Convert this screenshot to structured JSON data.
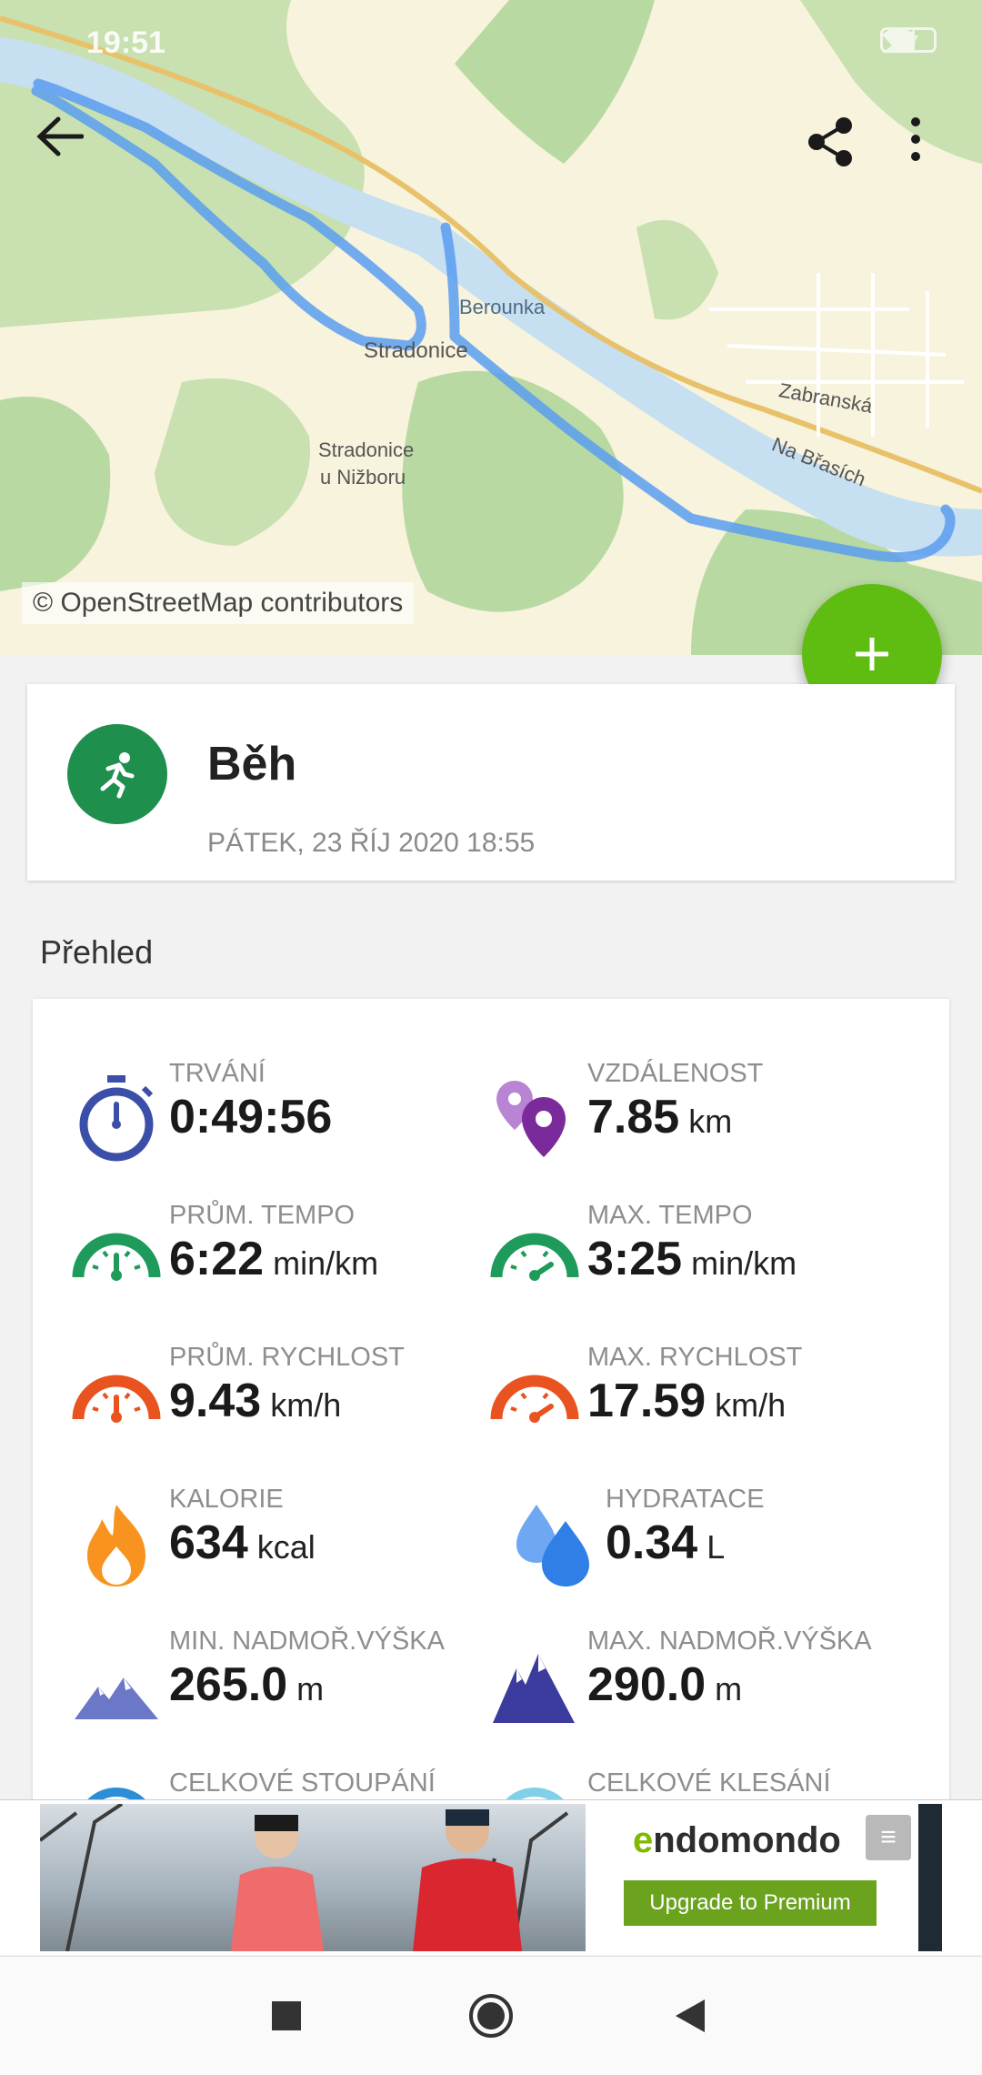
{
  "status_bar": {
    "time": "19:51",
    "battery": "77"
  },
  "map": {
    "attribution": "© OpenStreetMap contributors",
    "labels": {
      "river": "Berounka",
      "town1": "Stradonice",
      "town2_line1": "Stradonice",
      "town2_line2": "u Nižboru",
      "street1": "Zabranská",
      "street2": "Na Břasích"
    }
  },
  "toolbar": {
    "back_icon": "arrow-left-icon",
    "share_icon": "share-icon",
    "more_icon": "more-vert-icon"
  },
  "fab": {
    "icon": "plus-icon",
    "color": "#5fbd12"
  },
  "activity": {
    "title": "Běh",
    "date": "PÁTEK, 23 ŘÍJ 2020 18:55",
    "icon": "runner-icon",
    "icon_color": "#1f8f4e"
  },
  "overview": {
    "title": "Přehled",
    "stats": [
      {
        "label": "TRVÁNÍ",
        "value": "0:49:56",
        "unit": "",
        "icon": "stopwatch-icon"
      },
      {
        "label": "VZDÁLENOST",
        "value": "7.85",
        "unit": "km",
        "icon": "location-pins-icon"
      },
      {
        "label": "PRŮM. TEMPO",
        "value": "6:22",
        "unit": "min/km",
        "icon": "gauge-green-icon"
      },
      {
        "label": "MAX. TEMPO",
        "value": "3:25",
        "unit": "min/km",
        "icon": "gauge-green-max-icon"
      },
      {
        "label": "PRŮM. RYCHLOST",
        "value": "9.43",
        "unit": "km/h",
        "icon": "gauge-red-icon"
      },
      {
        "label": "MAX. RYCHLOST",
        "value": "17.59",
        "unit": "km/h",
        "icon": "gauge-red-max-icon"
      },
      {
        "label": "KALORIE",
        "value": "634",
        "unit": "kcal",
        "icon": "flame-icon"
      },
      {
        "label": "HYDRATACE",
        "value": "0.34",
        "unit": "L",
        "icon": "water-drops-icon"
      },
      {
        "label": "MIN. NADMOŘ.VÝŠKA",
        "value": "265.0",
        "unit": "m",
        "icon": "mountain-low-icon"
      },
      {
        "label": "MAX. NADMOŘ.VÝŠKA",
        "value": "290.0",
        "unit": "m",
        "icon": "mountain-high-icon"
      },
      {
        "label": "CELKOVÉ STOUPÁNÍ",
        "value": "",
        "unit": "",
        "icon": "ascent-icon"
      },
      {
        "label": "CELKOVÉ KLESÁNÍ",
        "value": "",
        "unit": "",
        "icon": "descent-icon"
      }
    ]
  },
  "ad": {
    "brand_e": "e",
    "brand_rest": "ndomondo",
    "cta": "Upgrade to Premium",
    "badge": "≡"
  },
  "nav": {
    "recents_icon": "square-icon",
    "home_icon": "circle-icon",
    "back_icon": "triangle-back-icon"
  }
}
